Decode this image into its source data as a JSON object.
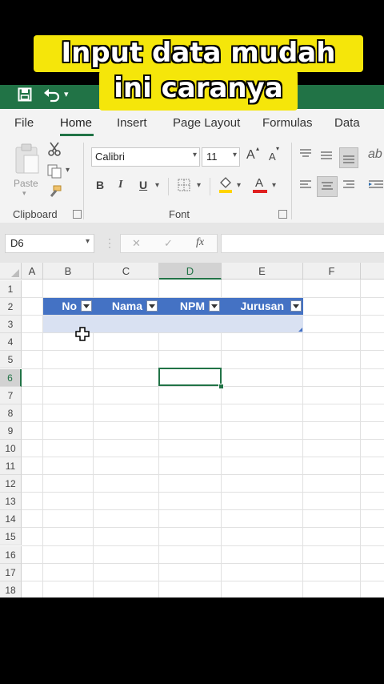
{
  "caption": {
    "line1": "Input data mudah",
    "line2": "ini caranya"
  },
  "tabs": [
    "File",
    "Home",
    "Insert",
    "Page Layout",
    "Formulas",
    "Data"
  ],
  "active_tab": "Home",
  "ribbon": {
    "clipboard_label": "Clipboard",
    "paste_label": "Paste",
    "font_label": "Font",
    "font_name": "Calibri",
    "font_size": "11",
    "grow_font": "A",
    "shrink_font": "A",
    "bold": "B",
    "italic": "I",
    "underline": "U",
    "font_color_glyph": "A"
  },
  "formula_bar": {
    "name_box": "D6",
    "cancel": "✕",
    "enter": "✓",
    "fx": "fx",
    "value": ""
  },
  "columns": [
    "A",
    "B",
    "C",
    "D",
    "E",
    "F"
  ],
  "rows": [
    "1",
    "2",
    "3",
    "4",
    "5",
    "6",
    "7",
    "8",
    "9",
    "10",
    "11",
    "12",
    "13",
    "14",
    "15",
    "16",
    "17",
    "18"
  ],
  "selected_cell": "D6",
  "table": {
    "headers": [
      "No",
      "Nama",
      "NPM",
      "Jurusan"
    ],
    "header_color": "#4472c4",
    "band_color": "#d9e1f2"
  },
  "colors": {
    "excel_green": "#217346"
  }
}
